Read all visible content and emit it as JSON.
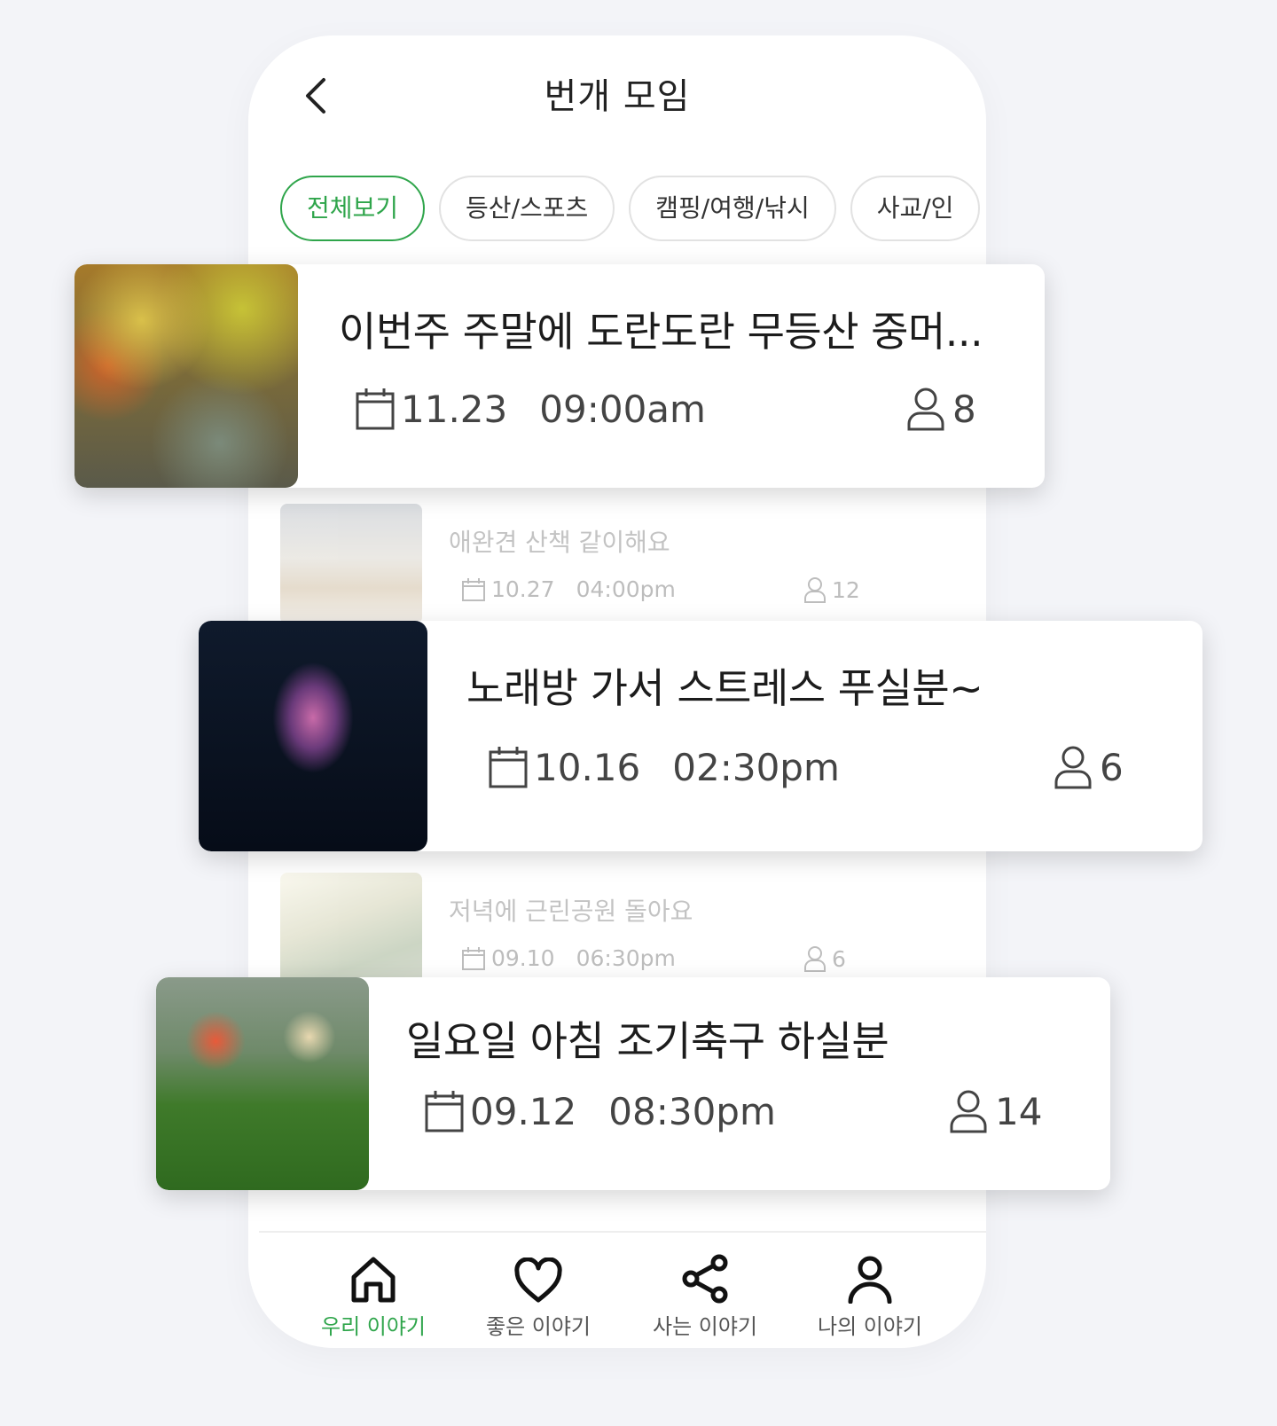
{
  "header": {
    "title": "번개 모임"
  },
  "filters": [
    {
      "label": "전체보기",
      "active": true
    },
    {
      "label": "등산/스포츠",
      "active": false
    },
    {
      "label": "캠핑/여행/낚시",
      "active": false
    },
    {
      "label": "사교/인",
      "active": false
    }
  ],
  "background_items": [
    {
      "title": "애완견 산책 같이해요",
      "date": "10.27",
      "time": "04:00pm",
      "people": "12"
    },
    {
      "title": "저녁에 근린공원 돌아요",
      "date": "09.10",
      "time": "06:30pm",
      "people": "6"
    }
  ],
  "featured_items": [
    {
      "title": "이번주 주말에 도란도란 무등산 중머...",
      "date": "11.23",
      "time": "09:00am",
      "people": "8",
      "image": "autumn-forest-stream"
    },
    {
      "title": "노래방 가서 스트레스 푸실분~",
      "date": "10.16",
      "time": "02:30pm",
      "people": "6",
      "image": "studio-microphone"
    },
    {
      "title": "일요일 아침 조기축구 하실분",
      "date": "09.12",
      "time": "08:30pm",
      "people": "14",
      "image": "soccer-kick"
    }
  ],
  "tabs": [
    {
      "label": "우리 이야기",
      "icon": "home-icon",
      "active": true
    },
    {
      "label": "좋은 이야기",
      "icon": "heart-icon",
      "active": false
    },
    {
      "label": "사는 이야기",
      "icon": "share-icon",
      "active": false
    },
    {
      "label": "나의 이야기",
      "icon": "user-icon",
      "active": false
    }
  ],
  "colors": {
    "accent": "#2fa54b",
    "background": "#f3f4f8",
    "text": "#222222"
  }
}
